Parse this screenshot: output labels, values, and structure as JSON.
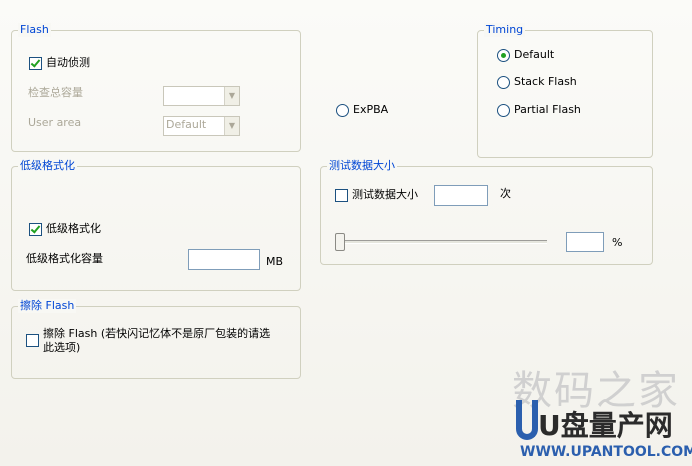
{
  "flash": {
    "title": "Flash",
    "auto_detect_label": "自动侦测",
    "auto_detect_checked": true,
    "check_capacity_label": "检查总容量",
    "check_capacity_value": "",
    "user_area_label": "User area",
    "user_area_value": "Default"
  },
  "expba": {
    "label": "ExPBA",
    "checked": false
  },
  "timing": {
    "title": "Timing",
    "options": [
      {
        "label": "Default",
        "checked": true
      },
      {
        "label": "Stack Flash",
        "checked": false
      },
      {
        "label": "Partial Flash",
        "checked": false
      }
    ]
  },
  "low_format": {
    "title": "低级格式化",
    "checkbox_label": "低级格式化",
    "checked": true,
    "capacity_label": "低级格式化容量",
    "capacity_value": "",
    "unit": "MB"
  },
  "test_data": {
    "title": "测试数据大小",
    "checkbox_label": "测试数据大小",
    "checked": false,
    "count_value": "",
    "count_unit": "次",
    "slider_percent": 0,
    "percent_value": "",
    "percent_unit": "%"
  },
  "erase": {
    "title": "擦除 Flash",
    "checkbox_label_line1": "擦除 Flash (若快闪记忆体不是原厂包装的请选",
    "checkbox_label_line2": "此选项)",
    "checked": false
  },
  "watermark": {
    "line1": "数码之家",
    "line2": "U盘量产网",
    "line3": "WWW.UPANTOOL.COM"
  }
}
